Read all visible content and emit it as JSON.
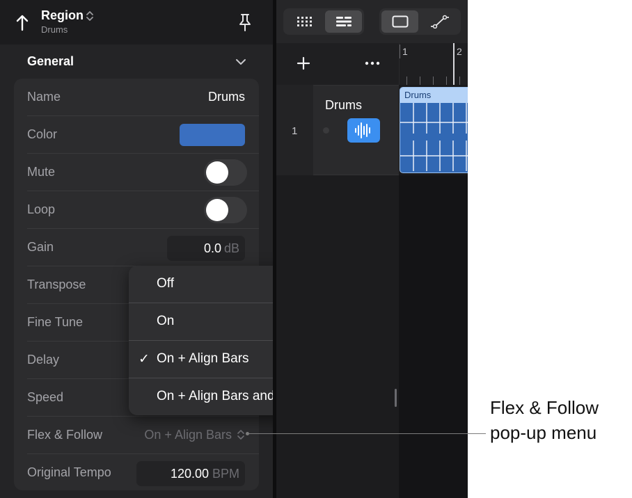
{
  "header": {
    "title": "Region",
    "subtitle": "Drums"
  },
  "section": {
    "title": "General"
  },
  "rows": {
    "name": {
      "label": "Name",
      "value": "Drums"
    },
    "color": {
      "label": "Color",
      "value": "#3a6fc0"
    },
    "mute": {
      "label": "Mute",
      "on": false
    },
    "loop": {
      "label": "Loop",
      "on": false
    },
    "gain": {
      "label": "Gain",
      "value": "0.0",
      "unit": "dB"
    },
    "transpose": {
      "label": "Transpose"
    },
    "fine_tune": {
      "label": "Fine Tune"
    },
    "delay": {
      "label": "Delay"
    },
    "speed": {
      "label": "Speed"
    },
    "flex_follow": {
      "label": "Flex & Follow",
      "value": "On + Align Bars"
    },
    "original_tempo": {
      "label": "Original Tempo",
      "value": "120.00",
      "unit": "BPM"
    }
  },
  "popup": {
    "selected": "On + Align Bars",
    "options": [
      "Off",
      "On",
      "On + Align Bars",
      "On + Align Bars and Beats"
    ],
    "check_mark": "✓"
  },
  "tracks": {
    "ruler": [
      "1",
      "2"
    ],
    "track_number": "1",
    "track_name": "Drums",
    "region_name": "Drums"
  },
  "callout": {
    "line1": "Flex & Follow",
    "line2": "pop-up menu"
  },
  "icons": {
    "back": "back-arrow-icon",
    "pin": "pin-icon",
    "grid": "grid-icon",
    "list": "list-icon",
    "window": "window-icon",
    "automation": "automation-icon",
    "plus": "plus-icon",
    "more": "more-icon",
    "waveform": "waveform-icon"
  }
}
